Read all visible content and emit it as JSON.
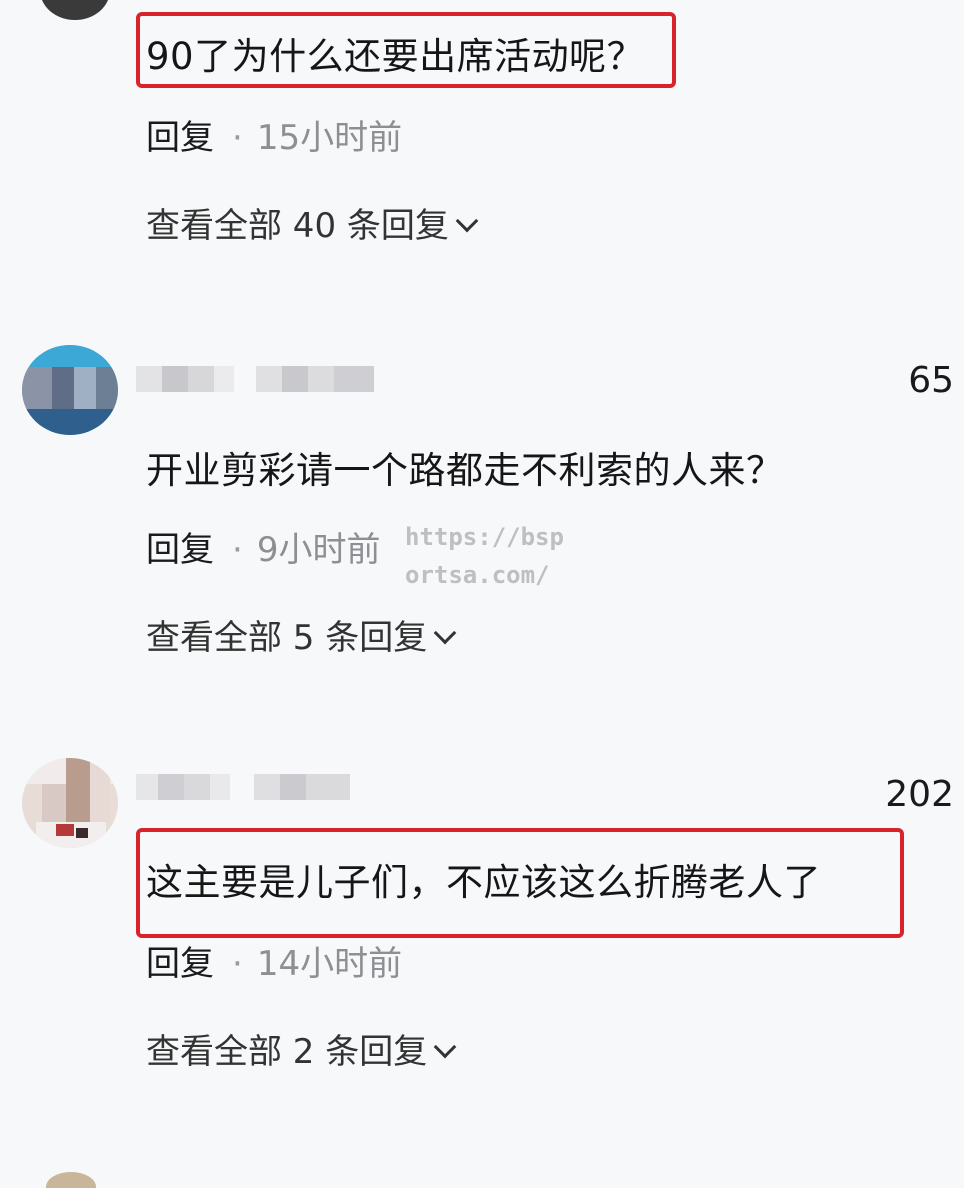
{
  "comments": [
    {
      "text": "90了为什么还要出席活动呢？",
      "reply_label": "回复",
      "separator": "·",
      "time": "15小时前",
      "view_all": "查看全部 40 条回复"
    },
    {
      "likes": "65",
      "text": "开业剪彩请一个路都走不利索的人来？",
      "reply_label": "回复",
      "separator": "·",
      "time": "9小时前",
      "view_all": "查看全部 5 条回复"
    },
    {
      "likes": "202",
      "text": "这主要是儿子们，不应该这么折腾老人了",
      "reply_label": "回复",
      "separator": "·",
      "time": "14小时前",
      "view_all": "查看全部 2 条回复"
    }
  ],
  "watermark": "https://bsportsa.com/",
  "icons": {
    "expand": "chevron-down-icon"
  },
  "colors": {
    "highlight": "#d8232a",
    "time_text": "#8e8e93",
    "background": "#f7f8fa"
  }
}
